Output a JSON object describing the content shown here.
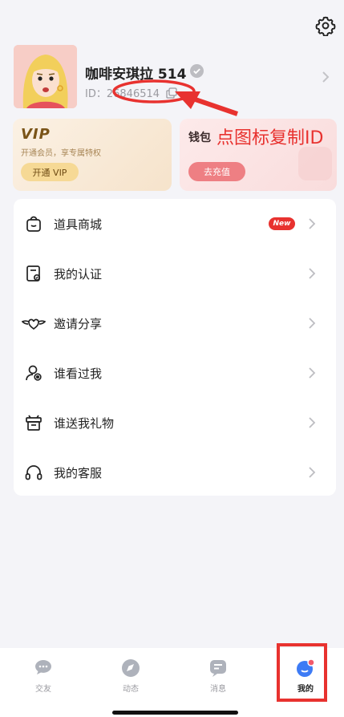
{
  "profile": {
    "nickname": "咖啡安琪拉 514",
    "id_prefix": "ID：",
    "id_value": "26846514"
  },
  "annotation": {
    "text": "点图标复制ID",
    "color": "#e8322f"
  },
  "vip_card": {
    "title": "VIP",
    "description": "开通会员，享专属特权",
    "button_label": "开通 VIP"
  },
  "wallet_card": {
    "title": "钱包",
    "button_label": "去充值"
  },
  "menu": {
    "items": [
      {
        "label": "道具商城",
        "icon": "shopping-bag-icon",
        "badge": "New"
      },
      {
        "label": "我的认证",
        "icon": "certificate-icon"
      },
      {
        "label": "邀请分享",
        "icon": "winged-heart-icon"
      },
      {
        "label": "谁看过我",
        "icon": "profile-viewers-icon"
      },
      {
        "label": "谁送我礼物",
        "icon": "gift-box-icon"
      },
      {
        "label": "我的客服",
        "icon": "headset-icon"
      }
    ]
  },
  "tabbar": {
    "tabs": [
      {
        "label": "交友",
        "icon": "chat-bubble-icon",
        "active": false
      },
      {
        "label": "动态",
        "icon": "compass-icon",
        "active": false
      },
      {
        "label": "消息",
        "icon": "message-icon",
        "active": false
      },
      {
        "label": "我的",
        "icon": "me-icon",
        "active": true
      }
    ]
  },
  "colors": {
    "accent_red": "#e8322f",
    "active_tab": "#3d7bf5",
    "vip_gold": "#f6d995",
    "wallet_pink": "#ee7f83"
  }
}
